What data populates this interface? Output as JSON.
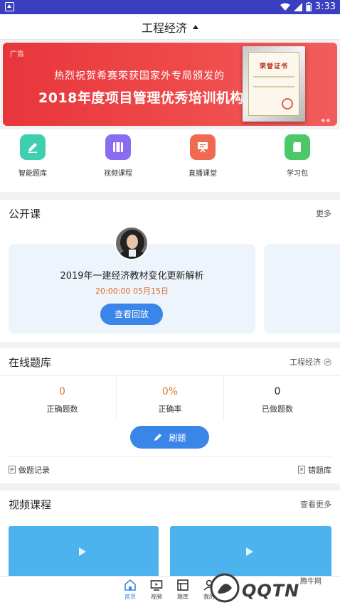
{
  "status_bar": {
    "time": "3:33"
  },
  "header": {
    "title": "工程经济"
  },
  "banner": {
    "ad_label": "广告",
    "line1": "热烈祝贺希赛荣获国家外专局颁发的",
    "line2": "2018年度项目管理优秀培训机构",
    "plaque_title": "荣誉证书"
  },
  "quick_menu": [
    {
      "label": "智能题库",
      "icon": "pencil-icon",
      "color": "#3ecfae"
    },
    {
      "label": "视频课程",
      "icon": "film-icon",
      "color": "#8a6cf0"
    },
    {
      "label": "直播课堂",
      "icon": "presentation-icon",
      "color": "#f06a52"
    },
    {
      "label": "学习包",
      "icon": "book-icon",
      "color": "#4cc86a"
    }
  ],
  "public_course": {
    "title": "公开课",
    "more": "更多",
    "card": {
      "title": "2019年一建经济教材变化更新解析",
      "time": "20:00:00  05月15日",
      "button": "查看回放"
    }
  },
  "question_bank": {
    "title": "在线题库",
    "subject": "工程经济",
    "stats": [
      {
        "value": "0",
        "label": "正确题数"
      },
      {
        "value": "0%",
        "label": "正确率"
      },
      {
        "value": "0",
        "label": "已做题数"
      }
    ],
    "brush_button": "刷题",
    "records": "做题记录",
    "wrong_bank": "错题库"
  },
  "video_course": {
    "title": "视频课程",
    "more": "查看更多"
  },
  "tab_bar": [
    {
      "label": "首页",
      "active": true
    },
    {
      "label": "视频",
      "active": false
    },
    {
      "label": "题库",
      "active": false
    },
    {
      "label": "我的",
      "active": false
    }
  ],
  "watermark": {
    "brand": "QQTN",
    "site": "腾牛网"
  },
  "colors": {
    "primary": "#3a86e8",
    "banner": "#e8353c",
    "status_bar": "#3a3fbf",
    "accent_orange": "#e07a2a"
  }
}
